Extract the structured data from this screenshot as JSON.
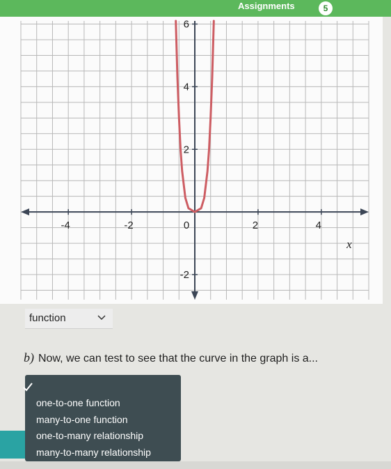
{
  "header": {
    "title": "Assignments",
    "badge_count": "5"
  },
  "chart_data": {
    "type": "line",
    "xlabel": "x",
    "x_ticks": [
      "-4",
      "-2",
      "0",
      "2",
      "4"
    ],
    "y_ticks": [
      "-2",
      "2",
      "4",
      "6"
    ],
    "xlim": [
      -5.5,
      5.5
    ],
    "ylim": [
      -2.8,
      6.1
    ],
    "grid": true,
    "series_color": "#cd5d63",
    "curve_x": [
      -0.6,
      -0.55,
      -0.5,
      -0.45,
      -0.4,
      -0.3,
      -0.2,
      0,
      0.2,
      0.3,
      0.4,
      0.45,
      0.5,
      0.55,
      0.6
    ],
    "curve_y": [
      6.1,
      4.3,
      3.0,
      2.0,
      1.3,
      0.45,
      0.12,
      0,
      0.12,
      0.45,
      1.3,
      2.0,
      3.0,
      4.3,
      6.1
    ]
  },
  "dropdown": {
    "value": "function"
  },
  "question": {
    "part_label": "b)",
    "text": "Now, we can test to see that the curve in the graph is a..."
  },
  "menu": {
    "options": [
      "one-to-one function",
      "many-to-one function",
      "one-to-many relationship",
      "many-to-many relationship"
    ]
  }
}
